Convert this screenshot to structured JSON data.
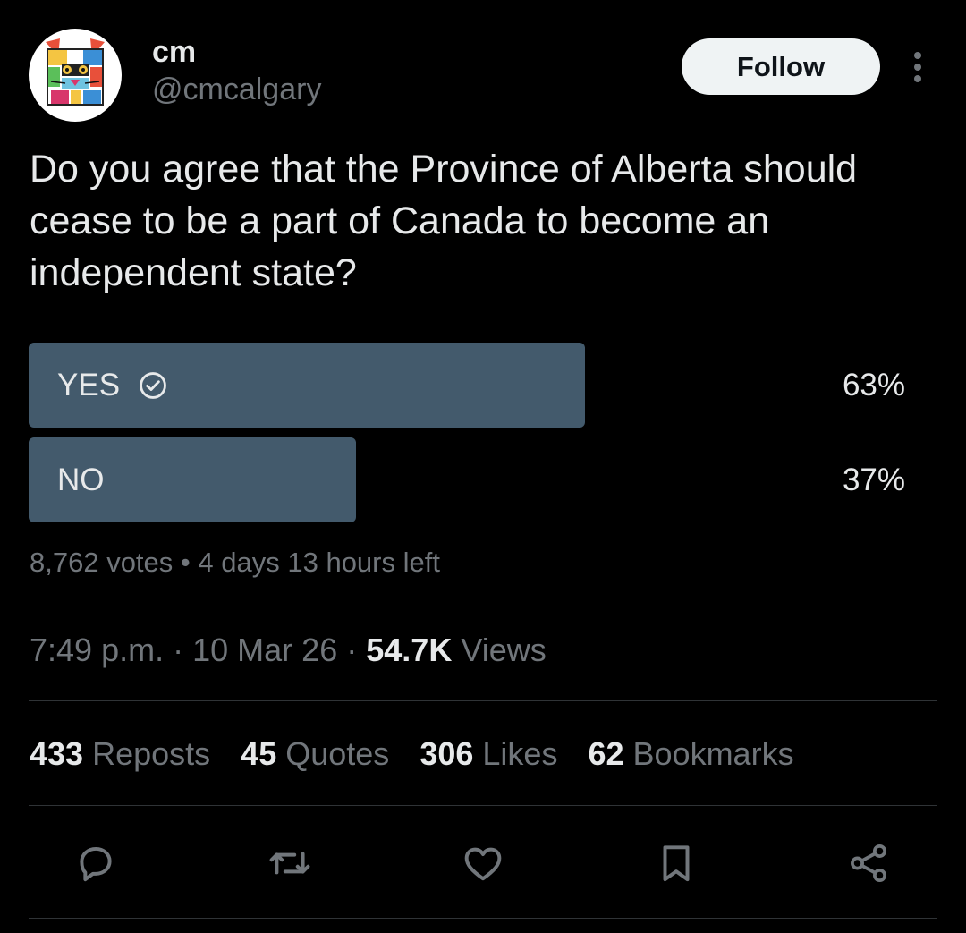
{
  "author": {
    "display_name": "cm",
    "handle": "@cmcalgary",
    "avatar_icon": "stylized-cat-face-avatar",
    "follow_label": "Follow",
    "more_icon": "more-vertical-icon"
  },
  "tweet": {
    "text": "Do you agree that the Province of Alberta should cease to be a part of Canada to become an independent state?"
  },
  "poll": {
    "options": [
      {
        "label": "YES",
        "percent_text": "63%",
        "percent": 63,
        "selected": true
      },
      {
        "label": "NO",
        "percent_text": "37%",
        "percent": 37,
        "selected": false
      }
    ],
    "votes_text": "8,762 votes",
    "separator": "•",
    "time_left": "4 days 13 hours left",
    "bar_color": "#435a6c"
  },
  "meta": {
    "time": "7:49 p.m.",
    "sep1": "·",
    "date": "10 Mar 26",
    "sep2": "·",
    "views_count": "54.7K",
    "views_label": "Views"
  },
  "stats": {
    "reposts_count": "433",
    "reposts_label": "Reposts",
    "quotes_count": "45",
    "quotes_label": "Quotes",
    "likes_count": "306",
    "likes_label": "Likes",
    "bookmarks_count": "62",
    "bookmarks_label": "Bookmarks"
  },
  "actions": [
    "reply-icon",
    "repost-icon",
    "like-icon",
    "bookmark-icon",
    "share-icon"
  ],
  "colors": {
    "background": "#000000",
    "primary_text": "#e7e9ea",
    "secondary_text": "#71767b",
    "divider": "#2f3336",
    "follow_bg": "#eff3f4"
  }
}
